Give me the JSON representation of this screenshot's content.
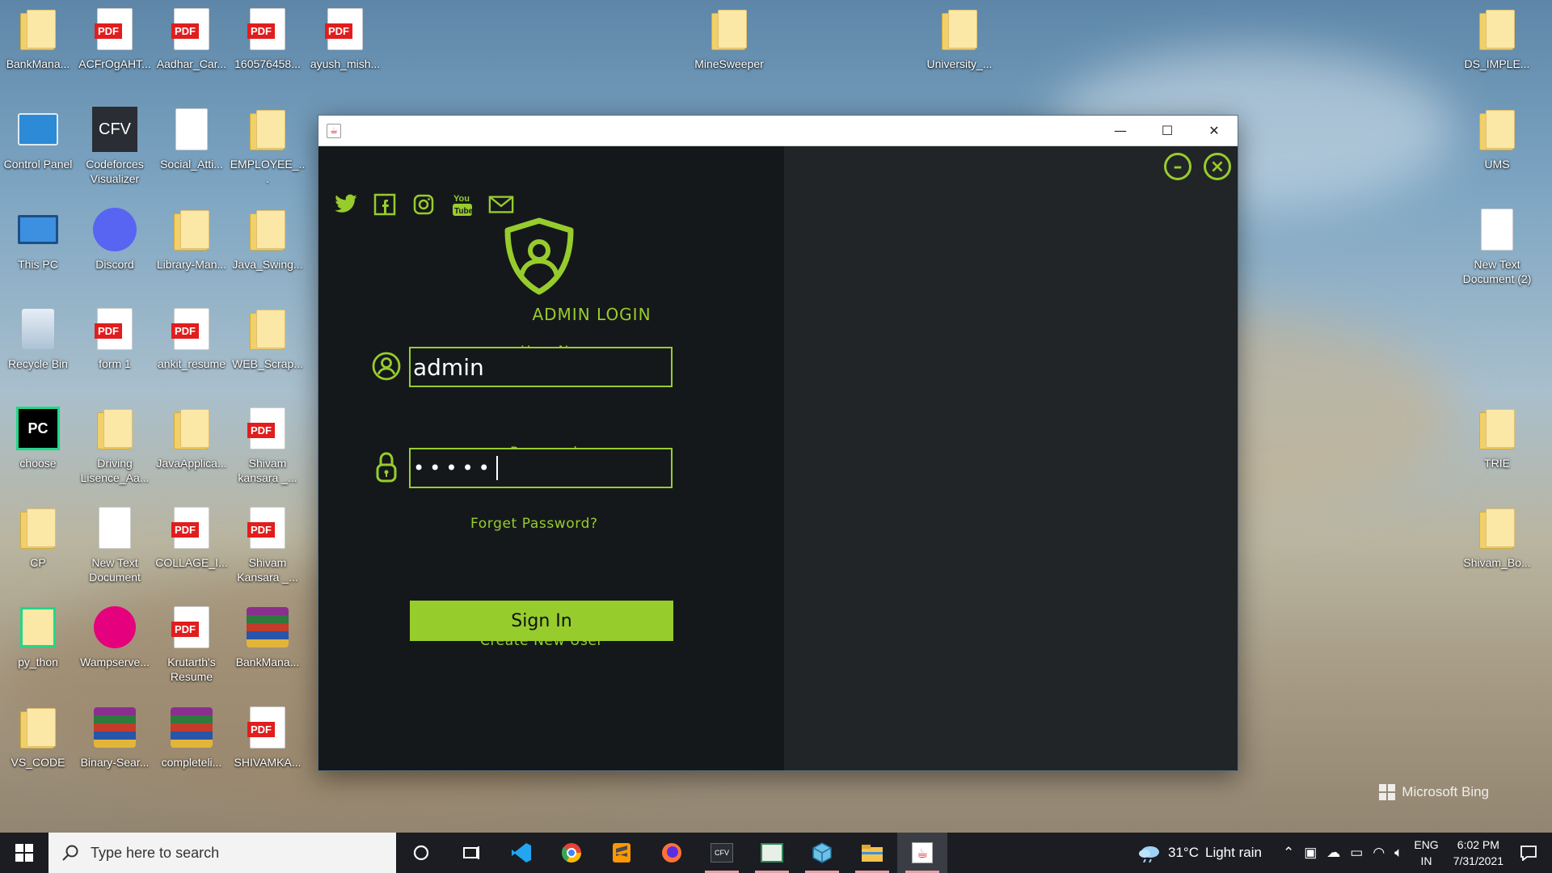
{
  "desktop": {
    "left_icons": [
      {
        "id": "bankmana-folder",
        "label": "BankMana...",
        "type": "folder"
      },
      {
        "id": "acfr-pdf",
        "label": "ACFrOgAHT...",
        "type": "pdf"
      },
      {
        "id": "aadhar-pdf",
        "label": "Aadhar_Car...",
        "type": "pdf"
      },
      {
        "id": "1605-pdf",
        "label": "160576458...",
        "type": "pdf"
      },
      {
        "id": "ayush-pdf",
        "label": "ayush_mish...",
        "type": "pdf"
      },
      {
        "id": "control-panel",
        "label": "Control Panel",
        "type": "app"
      },
      {
        "id": "cfv",
        "label": "Codeforces Visualizer",
        "type": "app"
      },
      {
        "id": "social-doc",
        "label": "Social_Atti...",
        "type": "doc"
      },
      {
        "id": "employee-folder",
        "label": "EMPLOYEE_...",
        "type": "folder"
      },
      {
        "id": "this-pc",
        "label": "This PC",
        "type": "app"
      },
      {
        "id": "discord",
        "label": "Discord",
        "type": "app"
      },
      {
        "id": "library-folder",
        "label": "Library-Man...",
        "type": "folder"
      },
      {
        "id": "javaswing-folder",
        "label": "Java_Swing...",
        "type": "folder"
      },
      {
        "id": "recycle-bin",
        "label": "Recycle Bin",
        "type": "app"
      },
      {
        "id": "form1-pdf",
        "label": "form 1",
        "type": "pdf"
      },
      {
        "id": "ankit-pdf",
        "label": "ankit_resume",
        "type": "pdf"
      },
      {
        "id": "webscrap-folder",
        "label": "WEB_Scrap...",
        "type": "folder"
      },
      {
        "id": "choose",
        "label": "choose",
        "type": "app"
      },
      {
        "id": "driving-folder",
        "label": "Driving Lisence_Aa...",
        "type": "folder"
      },
      {
        "id": "javaapp-folder",
        "label": "JavaApplica...",
        "type": "folder"
      },
      {
        "id": "shivam-pdf",
        "label": "Shivam kansara _...",
        "type": "pdf"
      },
      {
        "id": "cp-folder",
        "label": "CP",
        "type": "folder"
      },
      {
        "id": "newtext-doc",
        "label": "New Text Document",
        "type": "doc"
      },
      {
        "id": "collage-pdf",
        "label": "COLLAGE_I...",
        "type": "pdf"
      },
      {
        "id": "shivamk-pdf",
        "label": "Shivam Kansara _...",
        "type": "pdf"
      },
      {
        "id": "python",
        "label": "py_thon",
        "type": "app"
      },
      {
        "id": "wamp",
        "label": "Wampserve...",
        "type": "app"
      },
      {
        "id": "krutarth-pdf",
        "label": "Krutarth's Resume",
        "type": "pdf"
      },
      {
        "id": "bankmana-rar",
        "label": "BankMana...",
        "type": "rar"
      },
      {
        "id": "vscode-folder",
        "label": "VS_CODE",
        "type": "folder"
      },
      {
        "id": "binary-rar",
        "label": "Binary-Sear...",
        "type": "rar"
      },
      {
        "id": "complete-rar",
        "label": "completeli...",
        "type": "rar"
      },
      {
        "id": "shivamka-pdf",
        "label": "SHIVAMKA...",
        "type": "pdf"
      }
    ],
    "top_icons": [
      {
        "label": "MineSweeper"
      },
      {
        "label": "University_..."
      }
    ],
    "right_icons": [
      {
        "label": "DS_IMPLE..."
      },
      {
        "label": "UMS"
      },
      {
        "label": "New Text Document (2)"
      },
      {
        "label": "TRIE"
      },
      {
        "label": "Shivam_Bo..."
      }
    ],
    "watermark": "Microsoft Bing",
    "pdf_badge": "PDF",
    "cfv_badge": "CFV",
    "pc_badge": "PC"
  },
  "window": {
    "minimize": "—",
    "maximize": "☐",
    "close": "✕",
    "social_icons": [
      "twitter-icon",
      "facebook-icon",
      "instagram-icon",
      "youtube-icon",
      "mail-icon"
    ],
    "title": "ADMIN LOGIN",
    "username_label": "User Name",
    "username_value": "admin",
    "password_label": "Password",
    "password_value": "•••••",
    "forget_password": "Forget Password?",
    "sign_in": "Sign In",
    "create_user": "Create New User",
    "accent_color": "#97cc2d",
    "panel_color": "#15181a",
    "right_panel_color": "#212527"
  },
  "taskbar": {
    "search_placeholder": "Type here to search",
    "apps": [
      "cortana",
      "task-view",
      "vscode",
      "chrome",
      "sublime",
      "firefox",
      "cfv",
      "app-x",
      "cube-app",
      "file-explorer",
      "java"
    ],
    "weather_temp": "31°C",
    "weather_desc": "Light rain",
    "lang_top": "ENG",
    "lang_bottom": "IN",
    "time": "6:02 PM",
    "date": "7/31/2021"
  }
}
